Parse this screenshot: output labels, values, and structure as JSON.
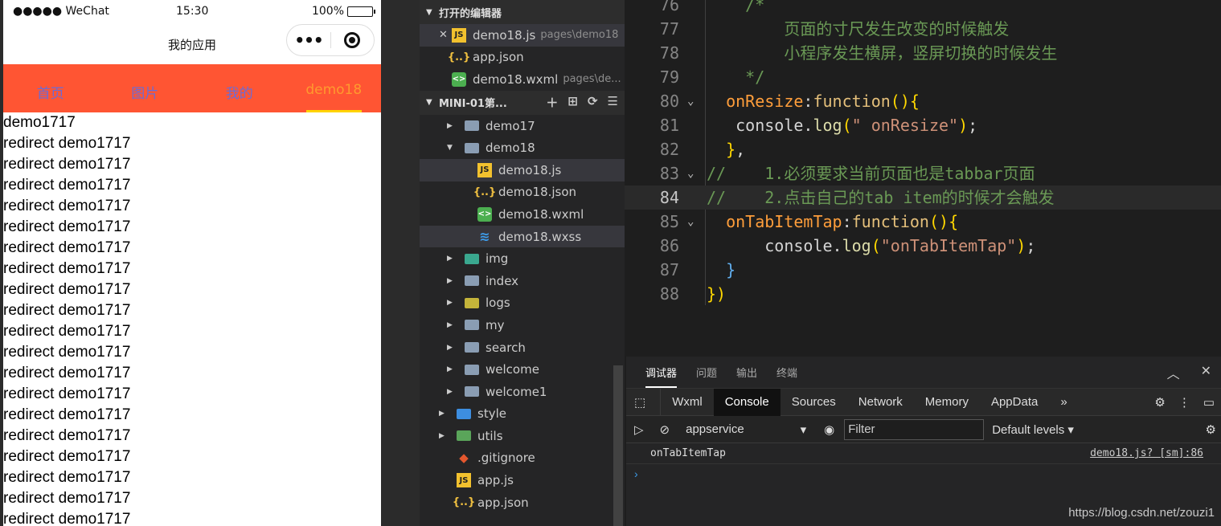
{
  "phone": {
    "carrier": "●●●●● WeChat",
    "time": "15:30",
    "battery": "100%",
    "nav_title": "我的应用",
    "tabs": [
      {
        "label": "首页",
        "active": false
      },
      {
        "label": "图片",
        "active": false
      },
      {
        "label": "我的",
        "active": false
      },
      {
        "label": "demo18",
        "active": true
      }
    ],
    "lines": [
      "demo1717",
      "redirect demo1717",
      "redirect demo1717",
      "redirect demo1717",
      "redirect demo1717",
      "redirect demo1717",
      "redirect demo1717",
      "redirect demo1717",
      "redirect demo1717",
      "redirect demo1717",
      "redirect demo1717",
      "redirect demo1717",
      "redirect demo1717",
      "redirect demo1717",
      "redirect demo1717",
      "redirect demo1717",
      "redirect demo1717",
      "redirect demo1717",
      "redirect demo1717",
      "redirect demo1717"
    ]
  },
  "explorer": {
    "open_editors_title": "打开的编辑器",
    "open_editors": [
      {
        "name": "demo18.js",
        "path": "pages\\demo18",
        "icon": "js",
        "closeable": true
      },
      {
        "name": "app.json",
        "path": "",
        "icon": "json",
        "closeable": false
      },
      {
        "name": "demo18.wxml",
        "path": "pages\\de...",
        "icon": "wxml",
        "closeable": false
      }
    ],
    "project_title": "MINI-01第...",
    "tree": [
      {
        "name": "demo17",
        "type": "folder",
        "level": 2,
        "expanded": false
      },
      {
        "name": "demo18",
        "type": "folder",
        "level": 2,
        "expanded": true
      },
      {
        "name": "demo18.js",
        "type": "js",
        "level": 3,
        "selected": true
      },
      {
        "name": "demo18.json",
        "type": "json",
        "level": 3
      },
      {
        "name": "demo18.wxml",
        "type": "wxml",
        "level": 3
      },
      {
        "name": "demo18.wxss",
        "type": "wxss",
        "level": 3,
        "selected": true
      },
      {
        "name": "img",
        "type": "folder-img",
        "level": 2,
        "expanded": false
      },
      {
        "name": "index",
        "type": "folder",
        "level": 2,
        "expanded": false
      },
      {
        "name": "logs",
        "type": "folder-logs",
        "level": 2,
        "expanded": false
      },
      {
        "name": "my",
        "type": "folder",
        "level": 2,
        "expanded": false
      },
      {
        "name": "search",
        "type": "folder",
        "level": 2,
        "expanded": false
      },
      {
        "name": "welcome",
        "type": "folder",
        "level": 2,
        "expanded": false
      },
      {
        "name": "welcome1",
        "type": "folder",
        "level": 2,
        "expanded": false
      },
      {
        "name": "style",
        "type": "folder-style",
        "level": 1,
        "expanded": false
      },
      {
        "name": "utils",
        "type": "folder-utils",
        "level": 1,
        "expanded": false
      },
      {
        "name": ".gitignore",
        "type": "git",
        "level": 1
      },
      {
        "name": "app.js",
        "type": "js",
        "level": 1
      },
      {
        "name": "app.json",
        "type": "json",
        "level": 1
      }
    ]
  },
  "editor": {
    "current_line": "84",
    "lines": [
      {
        "n": "76",
        "fold": "",
        "html": "    <span class='c-com'>/*</span>"
      },
      {
        "n": "77",
        "fold": "",
        "html": "        <span class='c-com'>页面的寸尺发生改变的时候触发</span>"
      },
      {
        "n": "78",
        "fold": "",
        "html": "        <span class='c-com'>小程序发生横屏，竖屏切换的时候发生</span>"
      },
      {
        "n": "79",
        "fold": "",
        "html": "    <span class='c-com'>*/</span>"
      },
      {
        "n": "80",
        "fold": "⌄",
        "html": "  <span class='c-prop'>onResize</span><span class='c-plain'>:</span><span class='c-key'>function</span><span class='c-y'>()</span><span class='c-y'>{</span>"
      },
      {
        "n": "81",
        "fold": "",
        "html": "   <span class='c-plain'>console</span><span class='c-plain'>.</span><span class='c-fn'>log</span><span class='c-y'>(</span><span class='c-str'>\" onResize\"</span><span class='c-y'>)</span><span class='c-plain'>;</span>"
      },
      {
        "n": "82",
        "fold": "",
        "html": "  <span class='c-y'>}</span><span class='c-plain'>,</span>"
      },
      {
        "n": "83",
        "fold": "⌄",
        "html": "<span class='c-com'>//    1.必须要求当前页面也是tabbar页面</span>"
      },
      {
        "n": "84",
        "fold": "",
        "html": "<span class='c-com'>//    2.点击自己的tab item的时候才会触发</span>"
      },
      {
        "n": "85",
        "fold": "⌄",
        "html": "  <span class='c-prop'>onTabItemTap</span><span class='c-plain'>:</span><span class='c-key'>function</span><span class='c-y'>()</span><span class='c-y'>{</span>"
      },
      {
        "n": "86",
        "fold": "",
        "html": "      <span class='c-plain'>console</span><span class='c-plain'>.</span><span class='c-fn'>log</span><span class='c-y'>(</span><span class='c-str'>\"onTabItemTap\"</span><span class='c-y'>)</span><span class='c-plain'>;</span>"
      },
      {
        "n": "87",
        "fold": "",
        "html": "  <span class='c-blue'>}</span>"
      },
      {
        "n": "88",
        "fold": "",
        "html": "<span class='c-y'>}</span><span class='c-y'>)</span>"
      }
    ]
  },
  "devtools": {
    "top_tabs": [
      "调试器",
      "问题",
      "输出",
      "终端"
    ],
    "panel_tabs": [
      "Wxml",
      "Console",
      "Sources",
      "Network",
      "Memory",
      "AppData"
    ],
    "active_panel": "Console",
    "context": "appservice",
    "filter_placeholder": "Filter",
    "levels": "Default levels ▾",
    "log_text": "onTabItemTap",
    "log_source": "demo18.js? [sm]:86"
  },
  "watermark": "https://blog.csdn.net/zouzi1"
}
